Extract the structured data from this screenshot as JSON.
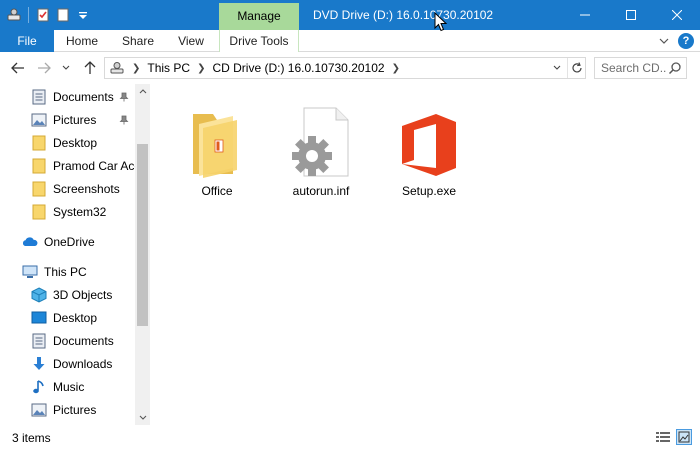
{
  "titlebar": {
    "title": "DVD Drive (D:) 16.0.10730.20102",
    "manage_tab": "Manage",
    "accent_color": "#1979ca",
    "manage_color": "#a8d99a"
  },
  "ribbon": {
    "file_label": "File",
    "tabs": [
      "Home",
      "Share",
      "View",
      "Drive Tools"
    ],
    "help_label": "?"
  },
  "address": {
    "crumbs": [
      "This PC",
      "CD Drive (D:) 16.0.10730.20102"
    ],
    "search_placeholder": "Search CD..."
  },
  "navpane": {
    "quick_access": [
      {
        "label": "Documents",
        "icon": "documents-icon",
        "pinned": true
      },
      {
        "label": "Pictures",
        "icon": "pictures-icon",
        "pinned": true
      },
      {
        "label": "Desktop",
        "icon": "folder-icon",
        "pinned": false
      },
      {
        "label": "Pramod Car Acc",
        "icon": "folder-icon",
        "pinned": false
      },
      {
        "label": "Screenshots",
        "icon": "folder-icon",
        "pinned": false
      },
      {
        "label": "System32",
        "icon": "folder-icon",
        "pinned": false
      }
    ],
    "onedrive": "OneDrive",
    "this_pc": "This PC",
    "this_pc_items": [
      {
        "label": "3D Objects",
        "icon": "3d-objects-icon"
      },
      {
        "label": "Desktop",
        "icon": "desktop-icon"
      },
      {
        "label": "Documents",
        "icon": "documents-icon"
      },
      {
        "label": "Downloads",
        "icon": "downloads-icon"
      },
      {
        "label": "Music",
        "icon": "music-icon"
      },
      {
        "label": "Pictures",
        "icon": "pictures-icon"
      }
    ]
  },
  "files": [
    {
      "name": "Office",
      "icon": "office-folder-icon"
    },
    {
      "name": "autorun.inf",
      "icon": "settings-file-icon"
    },
    {
      "name": "Setup.exe",
      "icon": "office-logo-icon"
    }
  ],
  "status": {
    "item_count": "3 items"
  }
}
